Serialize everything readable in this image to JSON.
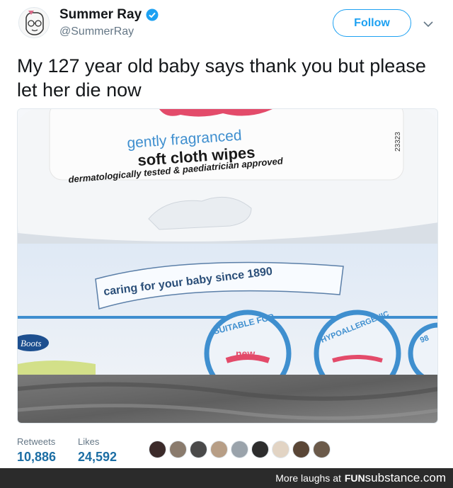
{
  "user": {
    "display_name": "Summer Ray",
    "handle": "@SummerRay",
    "verified_icon": "verified-badge-icon"
  },
  "actions": {
    "follow_label": "Follow",
    "menu_icon": "chevron-down-icon"
  },
  "tweet": {
    "text": "My 127 year old baby says thank you but please let her die now"
  },
  "media": {
    "label_line1": "gently fragranced",
    "label_line2": "soft cloth wipes",
    "label_line3": "dermatologically tested & paediatrician approved",
    "code": "23323",
    "banner": "caring for your baby since 1890",
    "brand": "Boots",
    "badge1_top": "SUITABLE FOR",
    "badge1_mid": "new",
    "badge2": "HYPOALLERGENIC",
    "badge3": "98"
  },
  "stats": {
    "retweets_label": "Retweets",
    "retweets_value": "10,886",
    "likes_label": "Likes",
    "likes_value": "24,592"
  },
  "footer": {
    "text": "More laughs at",
    "brand_bold": "FUN",
    "brand_rest": "substance.com"
  },
  "colors": {
    "accent": "#1da1f2",
    "stat_value": "#1c6ea4",
    "footer_bg": "#2b2b2b"
  }
}
